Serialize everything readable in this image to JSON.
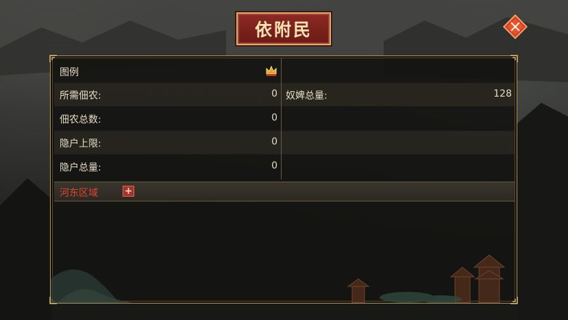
{
  "header": {
    "title": "依附民"
  },
  "panel": {
    "legend_label": "图例",
    "stats_left": [
      {
        "label": "所需佃农:",
        "value": "0"
      },
      {
        "label": "佃农总数:",
        "value": "0"
      },
      {
        "label": "隐户上限:",
        "value": "0"
      },
      {
        "label": "隐户总量:",
        "value": "0"
      }
    ],
    "stats_right": [
      {
        "label": "奴婢总量:",
        "value": "128"
      }
    ],
    "region": {
      "label": "河东区域",
      "expand_symbol": "+"
    }
  },
  "icons": {
    "close": "close-icon",
    "legend": "crown-icon",
    "expand": "plus-icon"
  },
  "colors": {
    "title_plate": "#7a211c",
    "title_text": "#f6e3b4",
    "region_text": "#e0442f",
    "panel_border": "#b8955a",
    "close_button": "#e9542c"
  }
}
